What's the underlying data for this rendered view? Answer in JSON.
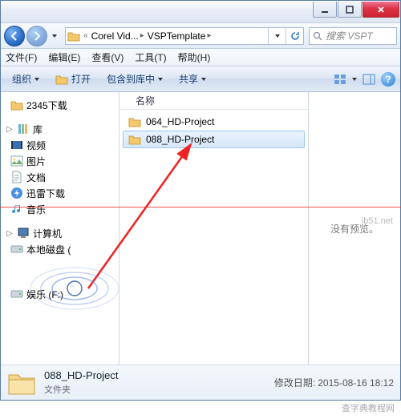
{
  "titlebar": {
    "min": "minimize",
    "max": "maximize",
    "close": "close"
  },
  "nav": {
    "back": "back",
    "forward": "forward"
  },
  "address": {
    "seg1": "Corel Vid...",
    "seg2": "VSPTemplate"
  },
  "search": {
    "placeholder": "搜索 VSPT"
  },
  "menubar": {
    "file": "文件(F)",
    "edit": "编辑(E)",
    "view": "查看(V)",
    "tools": "工具(T)",
    "help": "帮助(H)"
  },
  "toolbar": {
    "organize": "组织",
    "open": "打开",
    "include": "包含到库中",
    "share": "共享"
  },
  "tree": {
    "items": [
      {
        "label": "2345下载",
        "icon": "folder"
      },
      {
        "label": "库",
        "icon": "library",
        "root": true
      },
      {
        "label": "视频",
        "icon": "video"
      },
      {
        "label": "图片",
        "icon": "picture"
      },
      {
        "label": "文档",
        "icon": "doc"
      },
      {
        "label": "迅雷下载",
        "icon": "thunder"
      },
      {
        "label": "音乐",
        "icon": "music"
      },
      {
        "label": "计算机",
        "icon": "computer",
        "root": true
      },
      {
        "label": "本地磁盘 (",
        "icon": "drive"
      },
      {
        "label": "娱乐 (F:)",
        "icon": "drive"
      }
    ]
  },
  "content": {
    "column": "名称",
    "items": [
      {
        "label": "064_HD-Project"
      },
      {
        "label": "088_HD-Project"
      }
    ],
    "preview_empty": "没有预览。"
  },
  "status": {
    "name": "088_HD-Project",
    "type": "文件夹",
    "date_label": "修改日期:",
    "date_value": "2015-08-16 18:12"
  },
  "watermark": "查字典教程网",
  "watermark2": "jb51.net"
}
